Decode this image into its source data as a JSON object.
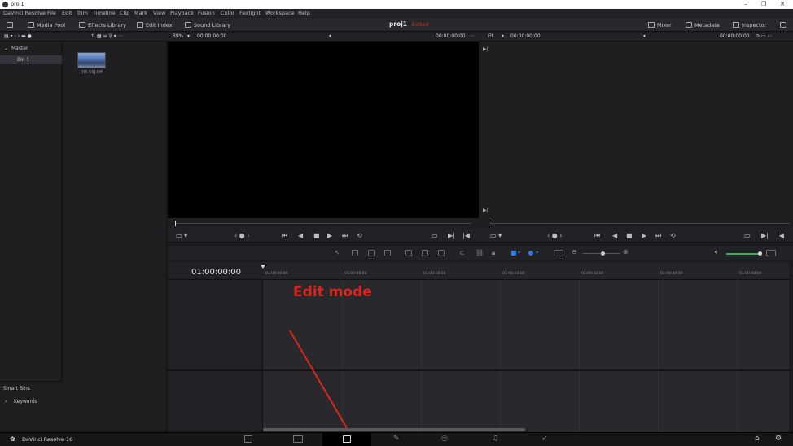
{
  "window": {
    "title": "proj1",
    "controls": [
      "–",
      "❐",
      "✕"
    ]
  },
  "menu": [
    "DaVinci Resolve",
    "File",
    "Edit",
    "Trim",
    "Timeline",
    "Clip",
    "Mark",
    "View",
    "Playback",
    "Fusion",
    "Color",
    "Fairlight",
    "Workspace",
    "Help"
  ],
  "toolbar": {
    "media_pool": "Media Pool",
    "effects_library": "Effects Library",
    "edit_index": "Edit Index",
    "sound_library": "Sound Library",
    "project_name": "proj1",
    "status": "Edited",
    "mixer": "Mixer",
    "metadata": "Metadata",
    "inspector": "Inspector"
  },
  "subbar": {
    "zoom": "39%",
    "source_tc_left": "00:00:00:00",
    "source_tc_right": "00:00:00:00",
    "fit": "Fit",
    "timeline_tc_left": "00:00:00:00",
    "timeline_tc_right": "00:00:00:00"
  },
  "sidebar": {
    "master": "Master",
    "bin": "Bin 1",
    "smart_bins": "Smart Bins",
    "keywords": "Keywords"
  },
  "media_pool": {
    "clip_label": "[00-59].tiff"
  },
  "timeline": {
    "timecode": "01:00:00:00",
    "ruler": [
      "01:00:00:00",
      "01:00:08:00",
      "01:00:16:00",
      "01:00:24:00",
      "01:00:32:00",
      "01:00:40:00",
      "01:00:48:00"
    ]
  },
  "annotation": {
    "text": "Edit mode",
    "color": "#d9261c"
  },
  "footer": {
    "app_name": "DaVinci Resolve 16",
    "pages": [
      "media-page-icon",
      "cut-page-icon",
      "edit-page-icon",
      "fusion-page-icon",
      "color-page-icon",
      "fairlight-page-icon",
      "deliver-page-icon"
    ],
    "active_page": "edit"
  }
}
